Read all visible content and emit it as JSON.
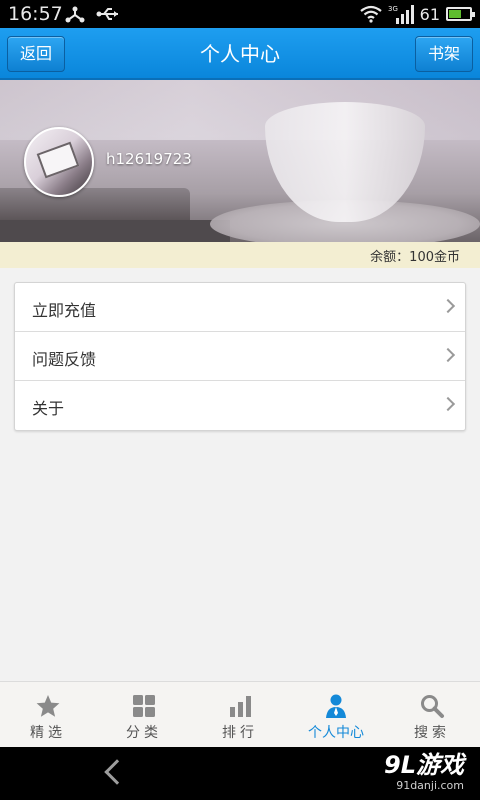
{
  "status_bar": {
    "time": "16:57",
    "signal_type": "3G",
    "battery_level": "61",
    "battery_fraction": 0.61,
    "icons": [
      "usb-tether-icon",
      "usb-icon",
      "wifi-icon",
      "cell-signal-icon",
      "battery-icon"
    ]
  },
  "header": {
    "title": "个人中心",
    "back_label": "返回",
    "bookshelf_label": "书架"
  },
  "profile": {
    "username": "h12619723",
    "balance": "余额：100金币"
  },
  "menu": {
    "items": [
      {
        "label": "立即充值"
      },
      {
        "label": "问题反馈"
      },
      {
        "label": "关于"
      }
    ]
  },
  "tabs": [
    {
      "label": "精选",
      "icon": "star-icon",
      "active": false
    },
    {
      "label": "分类",
      "icon": "grid-icon",
      "active": false
    },
    {
      "label": "排行",
      "icon": "bar-chart-icon",
      "active": false
    },
    {
      "label": "个人中心",
      "icon": "person-icon",
      "active": true
    },
    {
      "label": "搜索",
      "icon": "search-icon",
      "active": false
    }
  ],
  "watermark": {
    "main": "9L游戏",
    "sub": "91danji.com"
  },
  "colors": {
    "accent": "#0a86db",
    "tab_active": "#1489d8",
    "tab_inactive": "#8a8a8a",
    "balance_bg": "#f3eed2"
  }
}
